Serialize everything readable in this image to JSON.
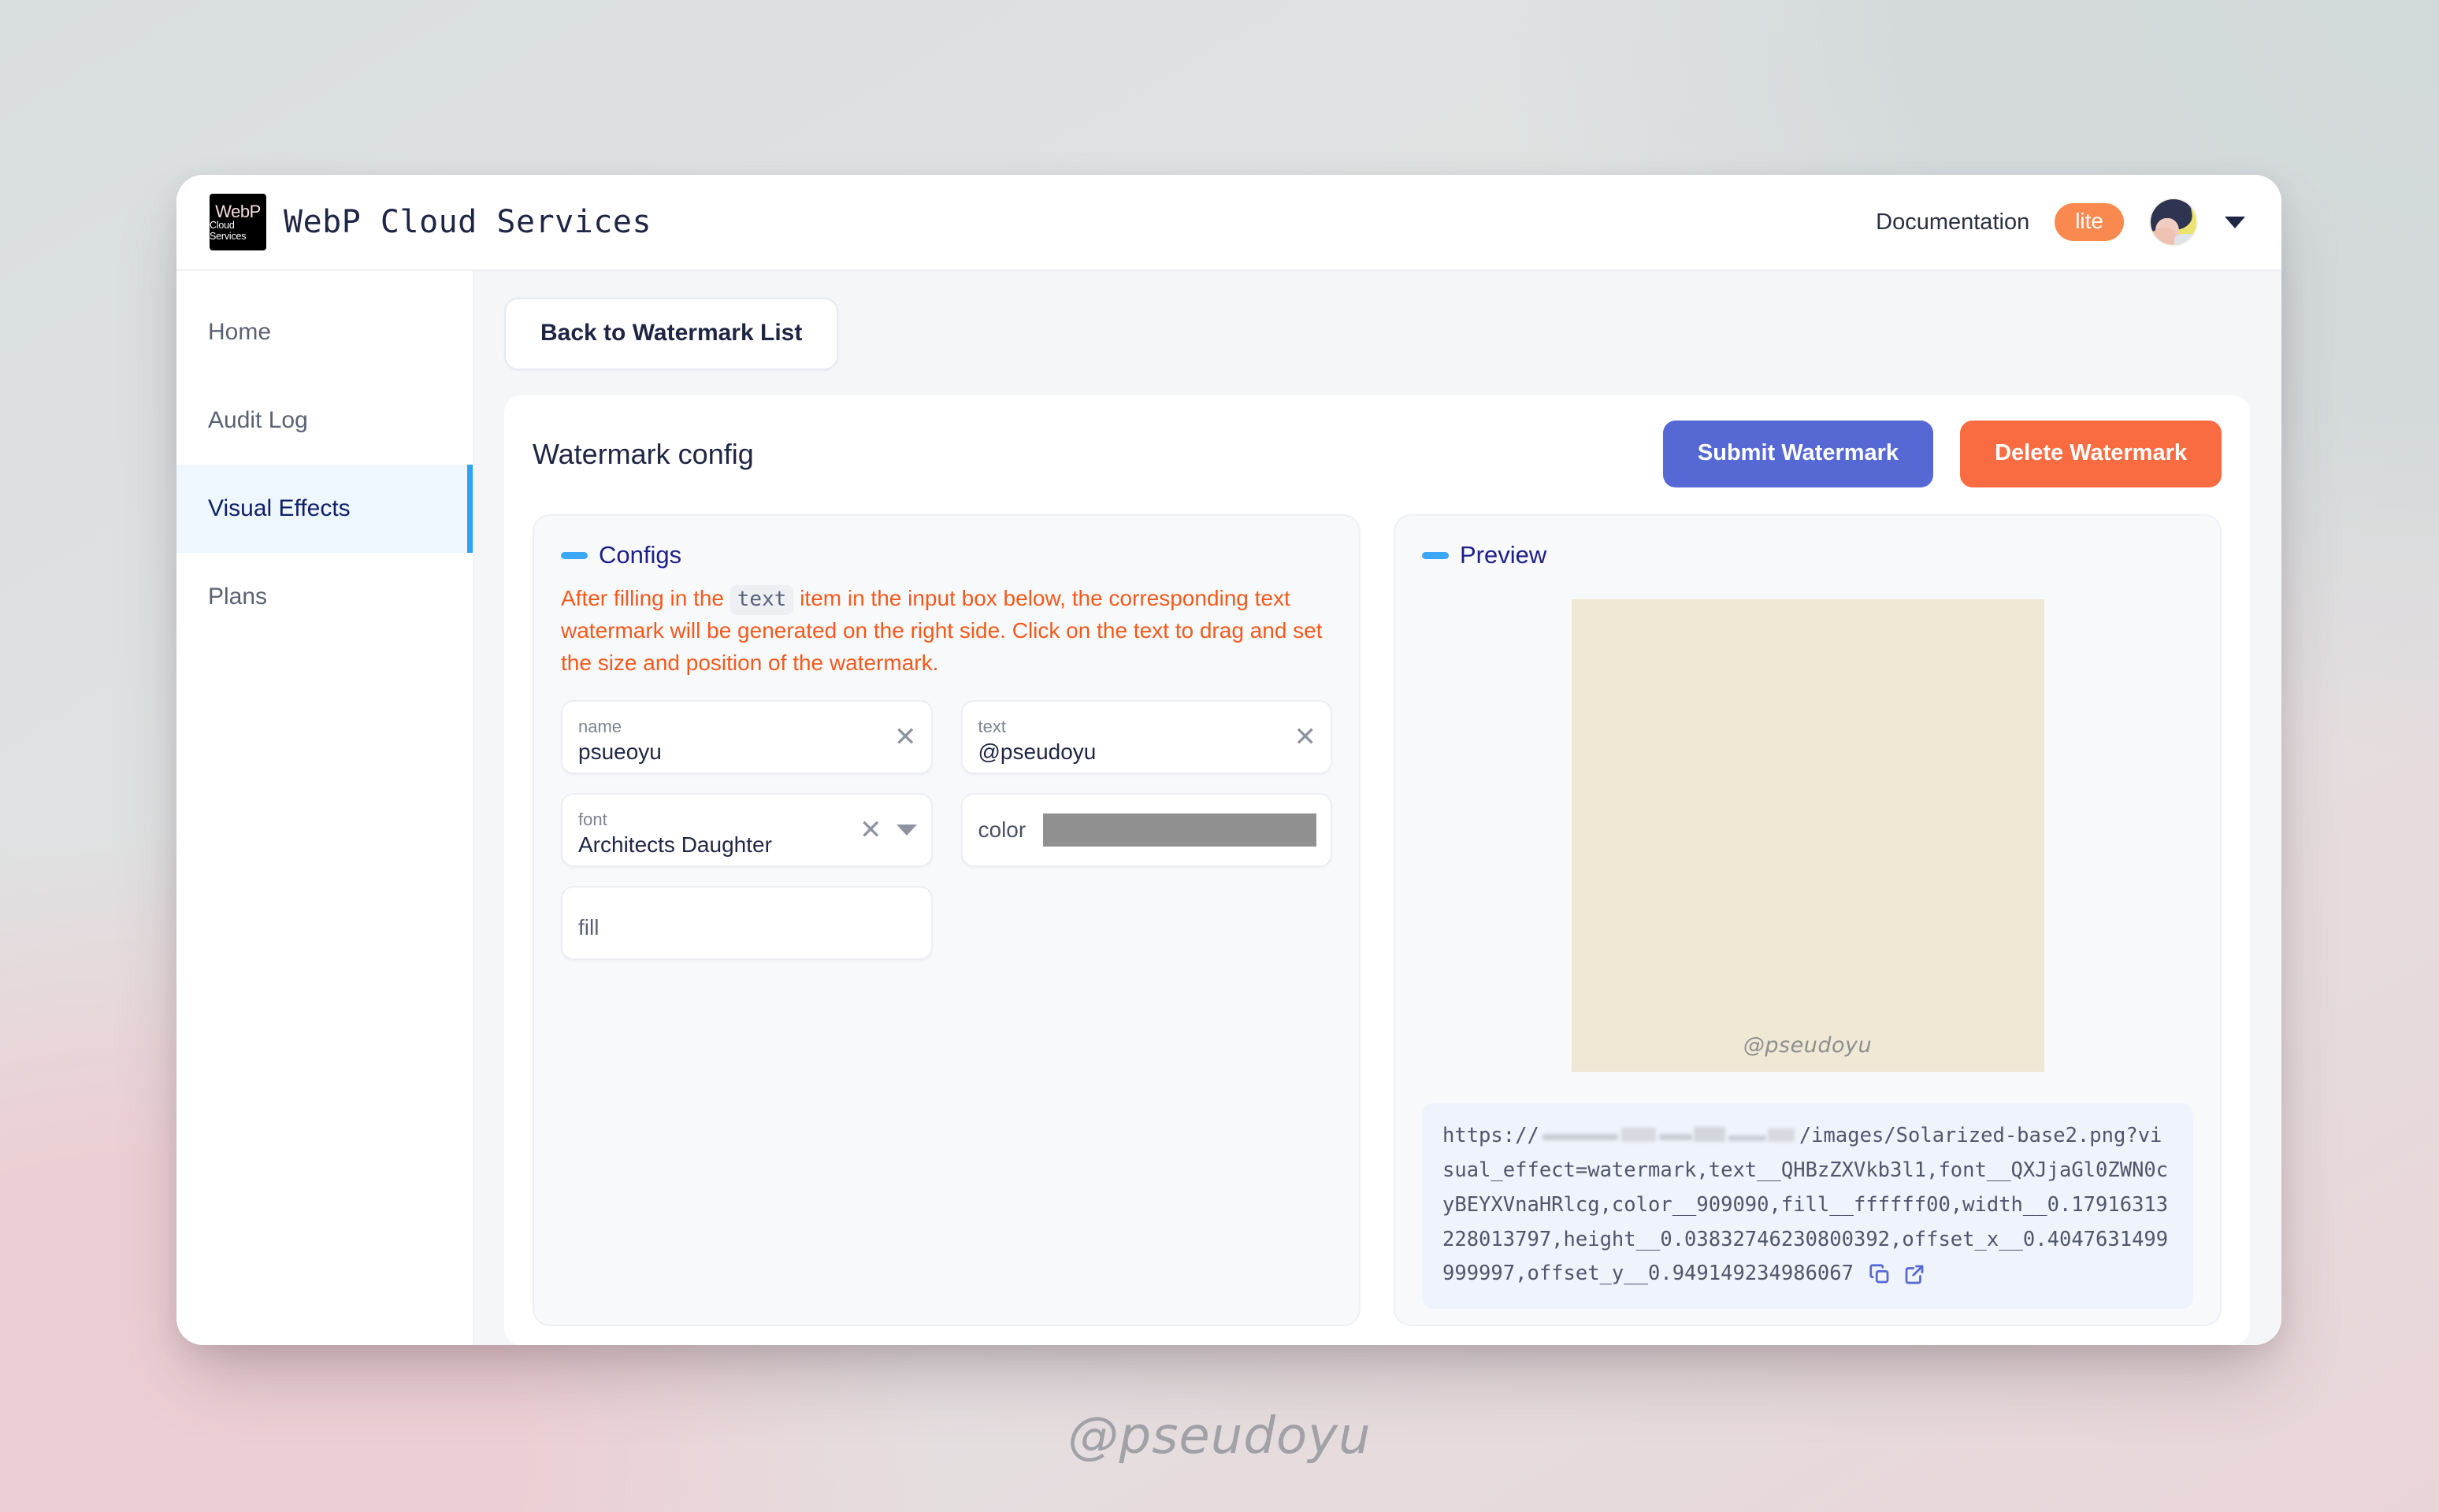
{
  "brand": {
    "logo_line1": "WebP",
    "logo_line2": "Cloud Services",
    "title": "WebP Cloud Services"
  },
  "topbar": {
    "documentation_label": "Documentation",
    "plan_badge": "lite",
    "badge_color": "#f9894e",
    "avatar_icon": "user-avatar",
    "dropdown_icon": "chevron-down-icon"
  },
  "sidebar": {
    "items": [
      {
        "label": "Home",
        "active": false
      },
      {
        "label": "Audit Log",
        "active": false
      },
      {
        "label": "Visual Effects",
        "active": true
      },
      {
        "label": "Plans",
        "active": false
      }
    ],
    "active_accent": "#30a2f5",
    "active_bg": "#eef6fe"
  },
  "main": {
    "back_button": "Back to Watermark List",
    "card_title": "Watermark config",
    "submit_button": "Submit Watermark",
    "submit_color": "#5568d4",
    "delete_button": "Delete Watermark",
    "delete_color": "#f96b41"
  },
  "configs_panel": {
    "title": "Configs",
    "accent": "#3aa8f7",
    "hint_before": "After filling in the",
    "hint_code": "text",
    "hint_after": "item in the input box below, the corresponding text watermark will be generated on the right side. Click on the text to drag and set the size and position of the watermark.",
    "hint_color": "#f4591c",
    "fields": {
      "name": {
        "label": "name",
        "value": "psueoyu",
        "clear_icon": "close-icon"
      },
      "text": {
        "label": "text",
        "value": "@pseudoyu",
        "clear_icon": "close-icon"
      },
      "font": {
        "label": "font",
        "value": "Architects Daughter",
        "clear_icon": "close-icon",
        "dropdown_icon": "chevron-down-icon"
      },
      "color": {
        "label": "color",
        "value": "#909090"
      },
      "fill": {
        "label": "",
        "placeholder": "fill",
        "value": ""
      }
    }
  },
  "preview_panel": {
    "title": "Preview",
    "accent": "#3aa8f7",
    "image_bg_color": "#eee8d5",
    "image_watermark_text": "@pseudoyu",
    "url_prefix": "https://",
    "url_redacted_host": "",
    "url_suffix": "/images/Solarized-base2.png?visual_effect=watermark,text__QHBzZXVkb3l1,font__QXJjaGl0ZWN0cyBEYXVnaHRlcg,color__909090,fill__ffffff00,width__0.17916313228013797,height__0.03832746230800392,offset_x__0.4047631499999997,offset_y__0.949149234986067",
    "copy_icon": "copy-icon",
    "open_icon": "external-link-icon",
    "icon_color": "#5568d4"
  },
  "page_watermark": "@pseudoyu"
}
